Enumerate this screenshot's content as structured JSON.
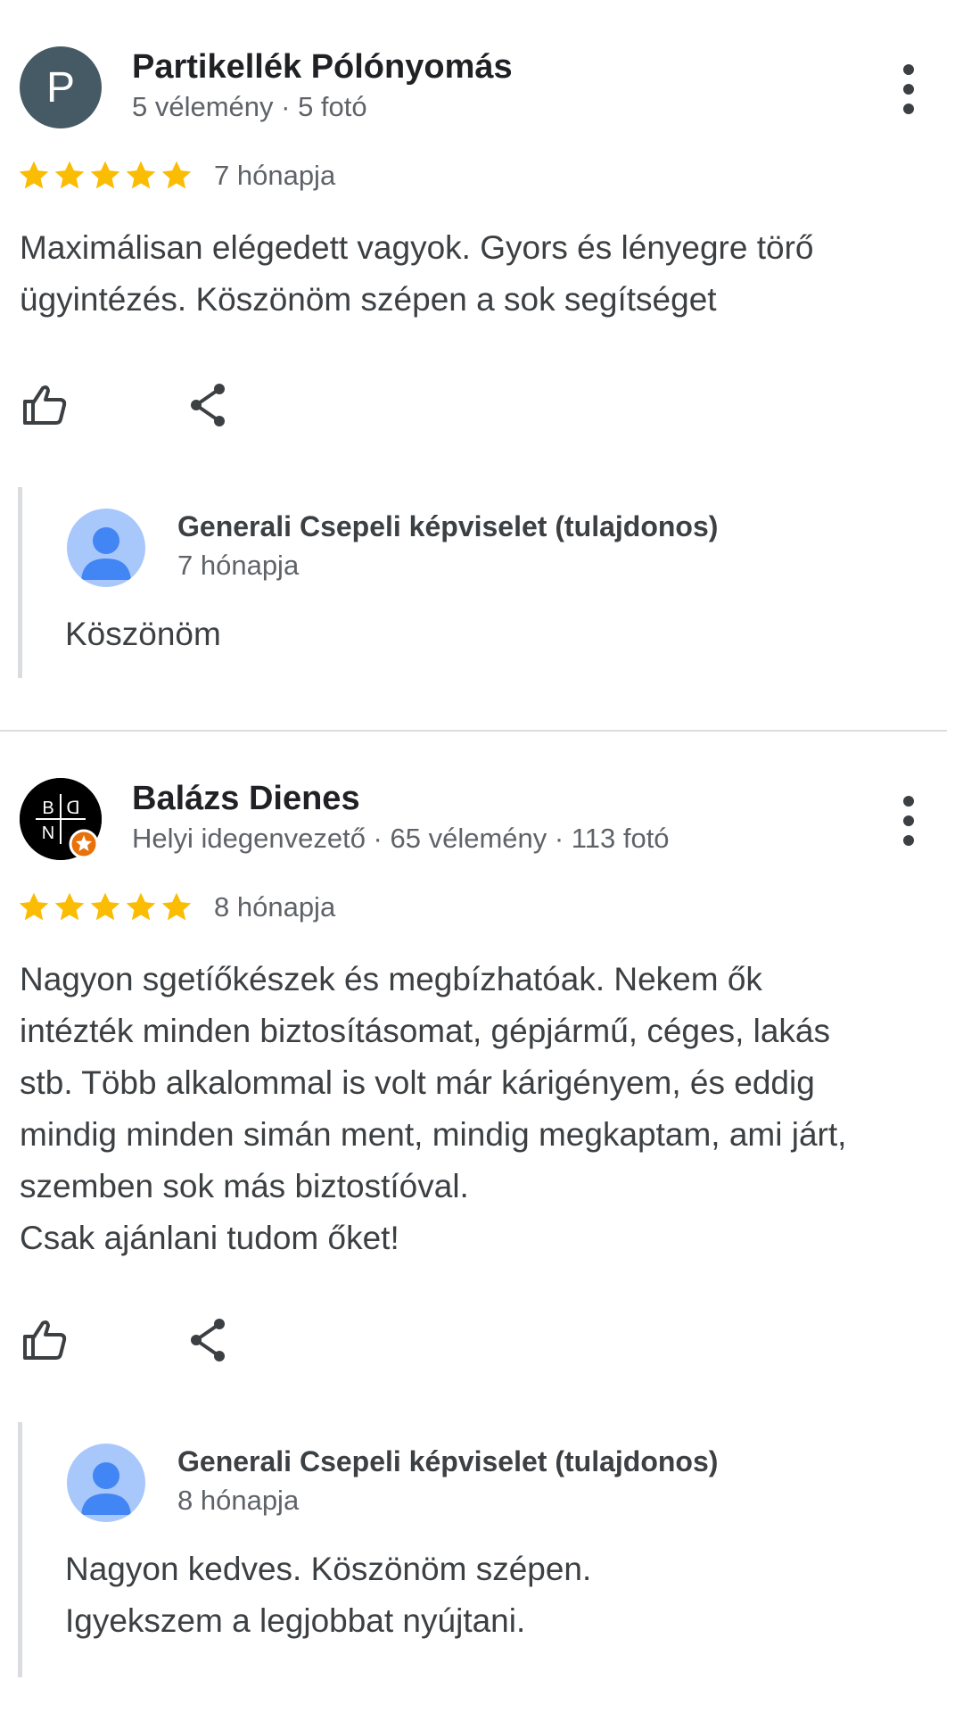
{
  "reviews": [
    {
      "avatar_letter": "P",
      "avatar_color": "#455a64",
      "name": "Partikellék Pólónyomás",
      "meta": "5 vélemény · 5 fotó",
      "stars": 5,
      "time": "7 hónapja",
      "text_lines": [
        "Maximálisan elégedett vagyok. Gyors és lényegre törő",
        "ügyintézés. Köszönöm szépen a sok segítséget"
      ],
      "actions": {
        "like_icon": "thumb-up-icon",
        "share_icon": "share-icon"
      },
      "reply": {
        "owner_name": "Generali Csepeli képviselet (tulajdonos)",
        "time": "7 hónapja",
        "text_lines": [
          "Köszönöm"
        ]
      }
    },
    {
      "avatar_logo_letters": [
        "B",
        "ᗡ",
        "N",
        ""
      ],
      "name": "Balázs Dienes",
      "meta": "Helyi idegenvezető · 65 vélemény · 113 fotó",
      "stars": 5,
      "time": "8 hónapja",
      "text_lines": [
        "Nagyon sgetíőkészek és megbízhatóak. Nekem ők",
        "intézték minden biztosításomat, gépjármű, céges, lakás",
        "stb. Több alkalommal is volt már kárigényem, és eddig",
        "mindig minden simán ment, mindig megkaptam, ami járt,",
        "szemben sok más biztostíóval.",
        "Csak ajánlani tudom őket!"
      ],
      "actions": {
        "like_icon": "thumb-up-icon",
        "share_icon": "share-icon"
      },
      "reply": {
        "owner_name": "Generali Csepeli képviselet (tulajdonos)",
        "time": "8 hónapja",
        "text_lines": [
          "Nagyon kedves. Köszönöm szépen.",
          "Igyekszem a legjobbat nyújtani."
        ]
      }
    }
  ],
  "colors": {
    "star": "#fbbc04",
    "local_guide_badge": "#e8710a",
    "owner_avatar_bg": "#a8c7fa",
    "owner_avatar_fg": "#4285f4"
  }
}
